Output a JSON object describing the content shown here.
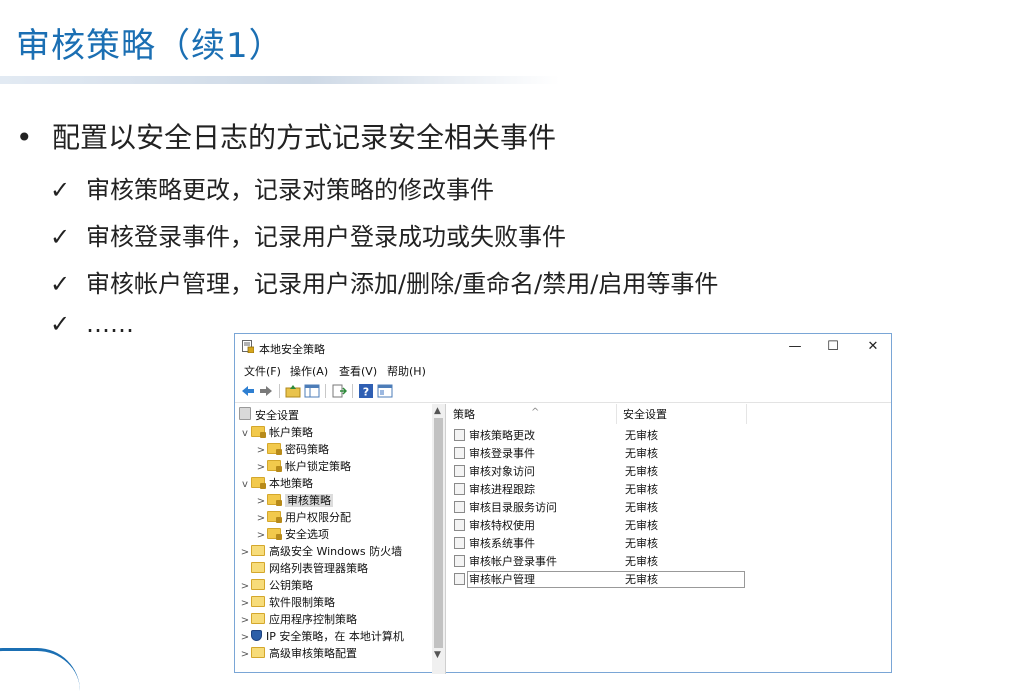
{
  "slide": {
    "title": "审核策略（续1）",
    "bullet_mark": "•",
    "bullet_text": "配置以安全日志的方式记录安全相关事件",
    "check_mark": "✓",
    "checks": [
      "审核策略更改，记录对策略的修改事件",
      "审核登录事件，记录用户登录成功或失败事件",
      "审核帐户管理，记录用户添加/删除/重命名/禁用/启用等事件",
      "……"
    ]
  },
  "window": {
    "title": "本地安全策略",
    "minimize": "—",
    "maximize": "☐",
    "close": "✕",
    "menu": [
      "文件(F)",
      "操作(A)",
      "查看(V)",
      "帮助(H)"
    ]
  },
  "tree": [
    {
      "label": "安全设置",
      "icon": "root"
    },
    {
      "label": "帐户策略",
      "icon": "lock",
      "chev": "v"
    },
    {
      "label": "密码策略",
      "icon": "lock",
      "chev": ">"
    },
    {
      "label": "帐户锁定策略",
      "icon": "lock",
      "chev": ">"
    },
    {
      "label": "本地策略",
      "icon": "lock",
      "chev": "v"
    },
    {
      "label": "审核策略",
      "icon": "lock",
      "chev": ">"
    },
    {
      "label": "用户权限分配",
      "icon": "lock",
      "chev": ">"
    },
    {
      "label": "安全选项",
      "icon": "lock",
      "chev": ">"
    },
    {
      "label": "高级安全 Windows 防火墙",
      "icon": "plain",
      "chev": ">"
    },
    {
      "label": "网络列表管理器策略",
      "icon": "plain",
      "chev": ""
    },
    {
      "label": "公钥策略",
      "icon": "plain",
      "chev": ">"
    },
    {
      "label": "软件限制策略",
      "icon": "plain",
      "chev": ">"
    },
    {
      "label": "应用程序控制策略",
      "icon": "plain",
      "chev": ">"
    },
    {
      "label": "IP 安全策略，在 本地计算机",
      "icon": "shield",
      "chev": ">"
    },
    {
      "label": "高级审核策略配置",
      "icon": "plain",
      "chev": ">"
    }
  ],
  "list": {
    "col_policy": "策略",
    "col_setting": "安全设置",
    "rows": [
      {
        "name": "审核策略更改",
        "value": "无审核"
      },
      {
        "name": "审核登录事件",
        "value": "无审核"
      },
      {
        "name": "审核对象访问",
        "value": "无审核"
      },
      {
        "name": "审核进程跟踪",
        "value": "无审核"
      },
      {
        "name": "审核目录服务访问",
        "value": "无审核"
      },
      {
        "name": "审核特权使用",
        "value": "无审核"
      },
      {
        "name": "审核系统事件",
        "value": "无审核"
      },
      {
        "name": "审核帐户登录事件",
        "value": "无审核"
      },
      {
        "name": "审核帐户管理",
        "value": "无审核"
      }
    ]
  }
}
